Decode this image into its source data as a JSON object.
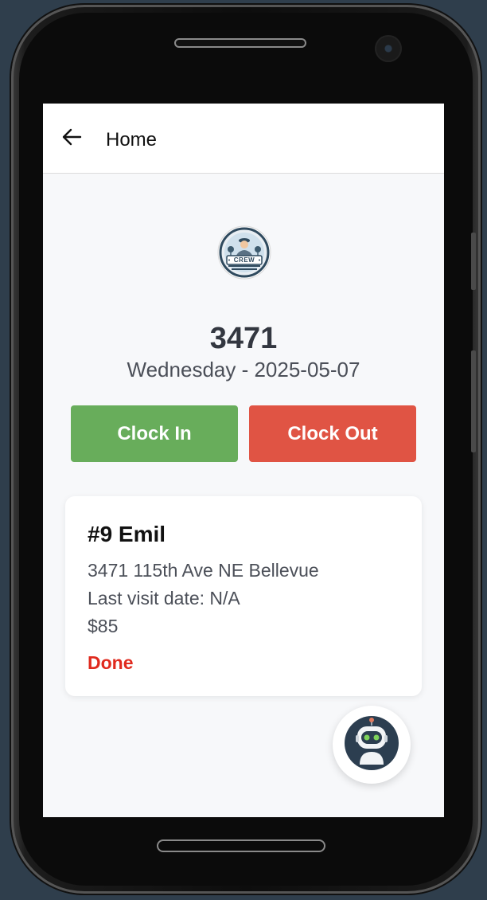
{
  "appbar": {
    "title": "Home",
    "back_icon": "arrow-left-icon"
  },
  "logo": {
    "text": "CREW",
    "icon": "crew-logo-icon"
  },
  "header": {
    "store_number": "3471",
    "date_line": "Wednesday - 2025-05-07"
  },
  "actions": {
    "clock_in_label": "Clock In",
    "clock_out_label": "Clock Out",
    "clock_in_color": "#68ad5b",
    "clock_out_color": "#e05444"
  },
  "job_card": {
    "title": "#9 Emil",
    "address": "3471 115th Ave NE Bellevue",
    "last_visit": "Last visit date: N/A",
    "price": "$85",
    "status": "Done",
    "status_color": "#e02a1e"
  },
  "assistant": {
    "icon": "robot-assistant-icon"
  }
}
